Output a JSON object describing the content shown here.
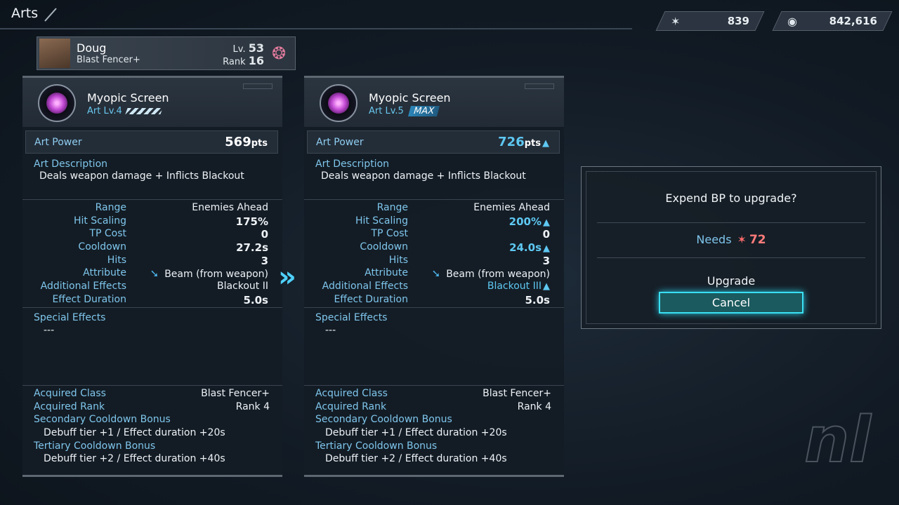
{
  "header": {
    "title": "Arts"
  },
  "currencies": [
    {
      "icon": "bp-icon",
      "value": "839"
    },
    {
      "icon": "credits-icon",
      "value": "842,616"
    }
  ],
  "character": {
    "name": "Doug",
    "class": "Blast Fencer+",
    "lv_label": "Lv.",
    "lv": "53",
    "rank_label": "Rank",
    "rank": "16"
  },
  "labels": {
    "art_power": "Art Power",
    "art_description": "Art Description",
    "special_effects": "Special Effects",
    "acquired_class": "Acquired Class",
    "acquired_rank": "Acquired Rank",
    "secondary_bonus": "Secondary Cooldown Bonus",
    "tertiary_bonus": "Tertiary Cooldown Bonus",
    "pts": "pts"
  },
  "stat_keys": [
    "Range",
    "Hit Scaling",
    "TP Cost",
    "Cooldown",
    "Hits",
    "Attribute",
    "Additional Effects",
    "Effect Duration"
  ],
  "current": {
    "name": "Myopic Screen",
    "lv": "Art Lv.4",
    "power": "569",
    "description": "Deals weapon damage + Inflicts Blackout",
    "stats": [
      "Enemies Ahead",
      "175%",
      "0",
      "27.2s",
      "3",
      "Beam (from weapon)",
      "Blackout II",
      "5.0s"
    ],
    "special": "---",
    "acquired_class": "Blast Fencer+",
    "acquired_rank": "Rank  4",
    "secondary_bonus": "Debuff tier +1 / Effect duration +20s",
    "tertiary_bonus": "Debuff tier +2 / Effect duration +40s"
  },
  "next": {
    "name": "Myopic Screen",
    "lv": "Art Lv.5",
    "max": "MAX",
    "power": "726",
    "description": "Deals weapon damage + Inflicts Blackout",
    "stats": [
      "Enemies Ahead",
      "200%",
      "0",
      "24.0s",
      "3",
      "Beam (from weapon)",
      "Blackout III",
      "5.0s"
    ],
    "special": "---",
    "acquired_class": "Blast Fencer+",
    "acquired_rank": "Rank  4",
    "secondary_bonus": "Debuff tier +1 / Effect duration +20s",
    "tertiary_bonus": "Debuff tier +2 / Effect duration +40s"
  },
  "dialog": {
    "question": "Expend BP to upgrade?",
    "needs_label": "Needs",
    "needs_value": "72",
    "upgrade_label": "Upgrade",
    "cancel_label": "Cancel"
  },
  "colors": {
    "accent": "#5ec8f2",
    "label": "#7fc6ec",
    "needs": "#ff7b7b",
    "highlight": "#39e0f2"
  }
}
